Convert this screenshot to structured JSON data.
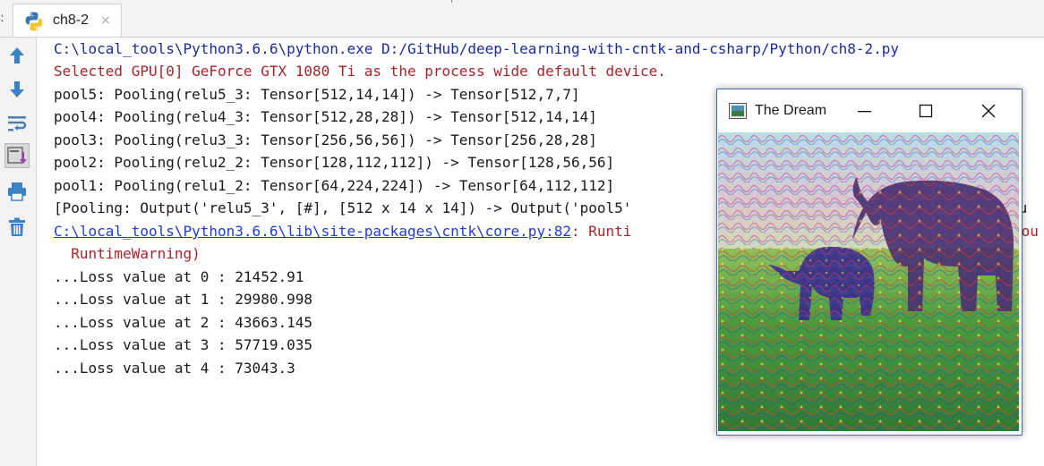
{
  "tab": {
    "title": "ch8-2",
    "close_glyph": "×",
    "icon": "python-icon"
  },
  "toolbar": {
    "buttons": [
      {
        "name": "up-arrow-icon"
      },
      {
        "name": "down-arrow-icon"
      },
      {
        "name": "soft-wrap-icon"
      },
      {
        "name": "scroll-to-end-icon",
        "active": true
      },
      {
        "name": "print-icon"
      },
      {
        "name": "trash-icon"
      }
    ]
  },
  "console": {
    "lines": [
      "C:\\local_tools\\Python3.6.6\\python.exe D:/GitHub/deep-learning-with-cntk-and-csharp/Python/ch8-2.py",
      "Selected GPU[0] GeForce GTX 1080 Ti as the process wide default device.",
      "pool5: Pooling(relu5_3: Tensor[512,14,14]) -> Tensor[512,7,7]",
      "pool4: Pooling(relu4_3: Tensor[512,28,28]) -> Tensor[512,14,14]",
      "pool3: Pooling(relu3_3: Tensor[256,56,56]) -> Tensor[256,28,28]",
      "pool2: Pooling(relu2_2: Tensor[128,112,112]) -> Tensor[128,56,56]",
      "pool1: Pooling(relu1_2: Tensor[64,224,224]) -> Tensor[64,112,112]",
      "[Pooling: Output('relu5_3', [#], [512 x 14 x 14]) -> Output('pool5'",
      "C:\\local_tools\\Python3.6.6\\lib\\site-packages\\cntk\\core.py:82",
      ": Runti",
      "  RuntimeWarning)",
      "...Loss value at 0 : 21452.91",
      "...Loss value at 1 : 29980.998",
      "...Loss value at 2 : 43663.145",
      "...Loss value at 3 : 57719.035",
      "...Loss value at 4 : 73043.3",
      "Ou",
      "uou"
    ]
  },
  "dream_window": {
    "title": "The Dream",
    "minimize_icon": "minimize-icon",
    "maximize_icon": "maximize-icon",
    "close_icon": "close-icon"
  },
  "colors": {
    "path_blue": "#1a2c9a",
    "warning_red": "#a8232a",
    "link_blue": "#1f3bd9",
    "window_border": "#3f6fa5"
  }
}
